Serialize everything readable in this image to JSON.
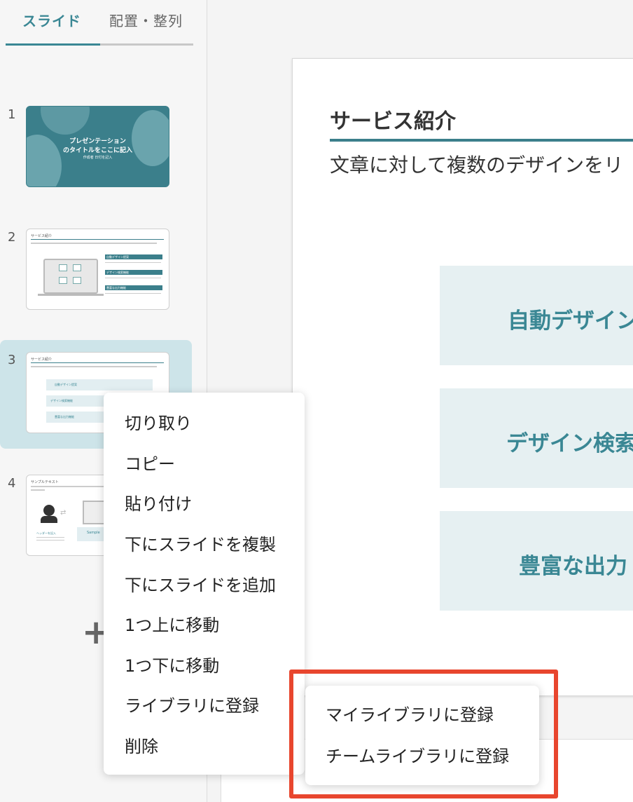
{
  "tabs": {
    "slides": "スライド",
    "arrange": "配置・整列"
  },
  "slides": [
    {
      "number": "1",
      "title_line1": "プレゼンテーション",
      "title_line2": "のタイトルをここに記入",
      "subtitle": "作成者 日付を記入"
    },
    {
      "number": "2",
      "heading": "サービス紹介",
      "items": [
        "自動デザイン提案",
        "デザイン検索機能",
        "豊富な出力機能"
      ]
    },
    {
      "number": "3",
      "heading": "サービス紹介",
      "items": [
        "自動デザイン提案",
        "デザイン検索機能",
        "豊富な出力機能"
      ]
    },
    {
      "number": "4",
      "heading": "サンプルテキスト",
      "caption": "ヘッダーを記入",
      "brand": "Sample"
    }
  ],
  "add_slide": "+",
  "canvas": {
    "title": "サービス紹介",
    "body": "文章に対して複数のデザインをリ",
    "features": [
      "自動デザイン",
      "デザイン検索",
      "豊富な出力"
    ]
  },
  "context_menu": {
    "items": [
      "切り取り",
      "コピー",
      "貼り付け",
      "下にスライドを複製",
      "下にスライドを追加",
      "1つ上に移動",
      "1つ下に移動",
      "ライブラリに登録",
      "削除"
    ]
  },
  "submenu": {
    "items": [
      "マイライブラリに登録",
      "チームライブラリに登録"
    ]
  },
  "colors": {
    "accent": "#3a8794",
    "highlight": "#e8462e",
    "selected_row": "#cde4e9"
  }
}
